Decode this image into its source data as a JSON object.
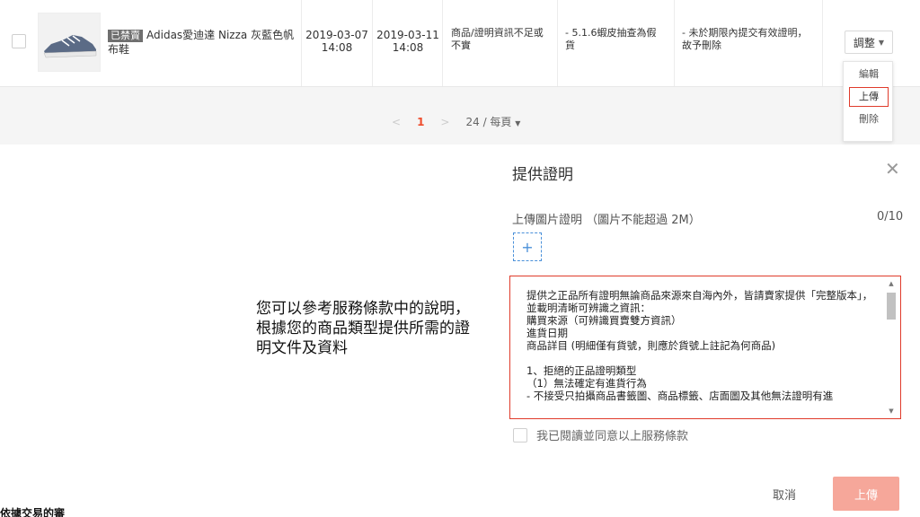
{
  "row": {
    "badge": "已禁賣",
    "product_name": "Adidas愛迪達 Nizza 灰藍色帆布鞋",
    "date_1": "2019-03-07\n14:08",
    "date_2": "2019-03-11\n14:08",
    "reason": "商品/證明資訊不足或不實",
    "note": "- 5.1.6蝦皮抽查為假貨",
    "status": "- 未於期限內提交有效證明，故予刪除",
    "adjust_label": "調整",
    "thumb_icon": "sneaker-image"
  },
  "pagination": {
    "prev": "<",
    "current": "1",
    "next": ">",
    "page_size": "24 / 每頁"
  },
  "menu": {
    "items": [
      "編輯",
      "上傳",
      "刪除"
    ]
  },
  "modal": {
    "title": "提供證明",
    "upload_label": "上傳圖片證明 （圖片不能超過 2M）",
    "upload_count": "0/10",
    "add_symbol": "+",
    "terms_text": "提供之正品所有證明無論商品來源來自海內外，皆請賣家提供「完整版本」，並載明清晰可辨識之資訊：\n購買來源（可辨識買賣雙方資訊）\n進貨日期\n商品詳目 (明細僅有貨號，則應於貨號上註記為何商品)\n\n1、拒絕的正品證明類型\n（1）無法確定有進貨行為\n- 不接受只拍攝商品書籤圖、商品標籤、店面圖及其他無法證明有進",
    "agree_label": "我已閱讀並同意以上服務條款",
    "cancel_label": "取消",
    "submit_label": "上傳"
  },
  "callout": "您可以參考服務條款中的說明，根據您的商品類型提供所需的證明文件及資料",
  "bottom_text": "依據交易的審"
}
